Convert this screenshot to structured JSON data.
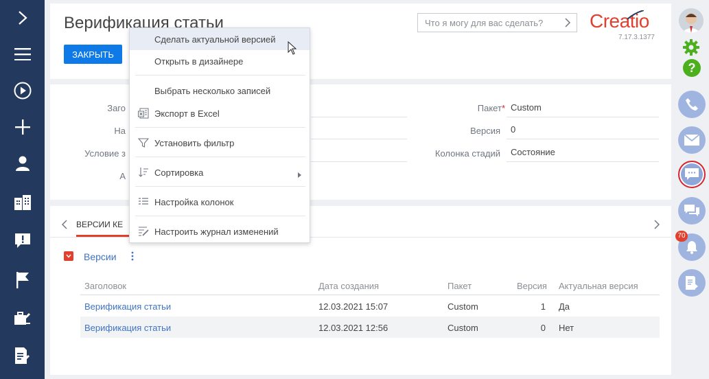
{
  "header": {
    "title": "Верификация статьи",
    "close_button": "ЗАКРЫТЬ",
    "search_placeholder": "Что я могу для вас сделать?",
    "logo": "Creatio",
    "version": "7.17.3.1377"
  },
  "fields": {
    "left_labels": [
      "Заго",
      "На",
      "Условие з",
      "А"
    ],
    "right": [
      {
        "label": "Пакет",
        "required": true,
        "value": "Custom"
      },
      {
        "label": "Версия",
        "required": false,
        "value": "0"
      },
      {
        "label": "Колонка стадий",
        "required": false,
        "value": "Состояние"
      }
    ]
  },
  "tabs": {
    "active": "ВЕРСИИ КЕ"
  },
  "detail": {
    "title": "Версии",
    "columns": [
      "Заголовок",
      "Дата создания",
      "Пакет",
      "Версия",
      "Актуальная версия"
    ],
    "rows": [
      {
        "title": "Верификация статьи",
        "created": "12.03.2021 15:07",
        "package": "Custom",
        "version": "1",
        "actual": "Да"
      },
      {
        "title": "Верификация статьи",
        "created": "12.03.2021 12:56",
        "package": "Custom",
        "version": "0",
        "actual": "Нет"
      }
    ]
  },
  "menu": {
    "items": [
      {
        "label": "Сделать актуальной версией",
        "icon": "none",
        "highlighted": true
      },
      {
        "label": "Открыть в дизайнере",
        "icon": "none"
      },
      {
        "label": "Выбрать несколько записей",
        "icon": "none"
      },
      {
        "label": "Экспорт в Excel",
        "icon": "excel-export-icon"
      },
      {
        "label": "Установить фильтр",
        "icon": "filter-icon"
      },
      {
        "label": "Сортировка",
        "icon": "sort-icon",
        "submenu": true
      },
      {
        "label": "Настройка колонок",
        "icon": "columns-icon"
      },
      {
        "label": "Настроить журнал изменений",
        "icon": "changelog-icon"
      }
    ]
  },
  "notifications": {
    "count": "70"
  },
  "colors": {
    "sidebar": "#23395d",
    "accent": "#e2402f",
    "primary_button": "#0d7ae8",
    "link": "#3f73c4",
    "green_icons": "#4caf1e"
  }
}
